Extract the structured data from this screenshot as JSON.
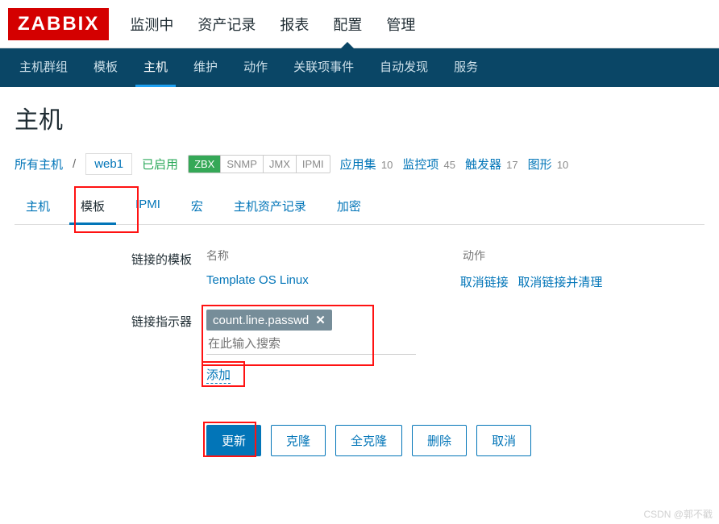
{
  "brand": "ZABBIX",
  "topnav": {
    "items": [
      "监测中",
      "资产记录",
      "报表",
      "配置",
      "管理"
    ],
    "active_index": 3
  },
  "subnav": {
    "items": [
      "主机群组",
      "模板",
      "主机",
      "维护",
      "动作",
      "关联项事件",
      "自动发现",
      "服务"
    ],
    "active_index": 2
  },
  "page_title": "主机",
  "breadcrumb": {
    "all_hosts": "所有主机",
    "host_name": "web1",
    "status_enabled": "已启用",
    "badges": [
      "ZBX",
      "SNMP",
      "JMX",
      "IPMI"
    ],
    "applications_label": "应用集",
    "applications_count": "10",
    "items_label": "监控项",
    "items_count": "45",
    "triggers_label": "触发器",
    "triggers_count": "17",
    "graphs_label": "图形",
    "graphs_count": "10"
  },
  "tabs": {
    "items": [
      "主机",
      "模板",
      "IPMI",
      "宏",
      "主机资产记录",
      "加密"
    ],
    "active_index": 1
  },
  "form": {
    "linked_templates_label": "链接的模板",
    "linked_table_header_name": "名称",
    "linked_table_header_action": "动作",
    "linked_template_name": "Template OS Linux",
    "linked_action_unlink": "取消链接",
    "linked_action_unlink_clear": "取消链接并清理",
    "link_indicator_label": "链接指示器",
    "token_value": "count.line.passwd",
    "search_placeholder": "在此输入搜索",
    "add_link": "添加"
  },
  "buttons": {
    "update": "更新",
    "clone": "克隆",
    "full_clone": "全克隆",
    "delete": "删除",
    "cancel": "取消"
  },
  "watermark": "CSDN @郭不戳"
}
